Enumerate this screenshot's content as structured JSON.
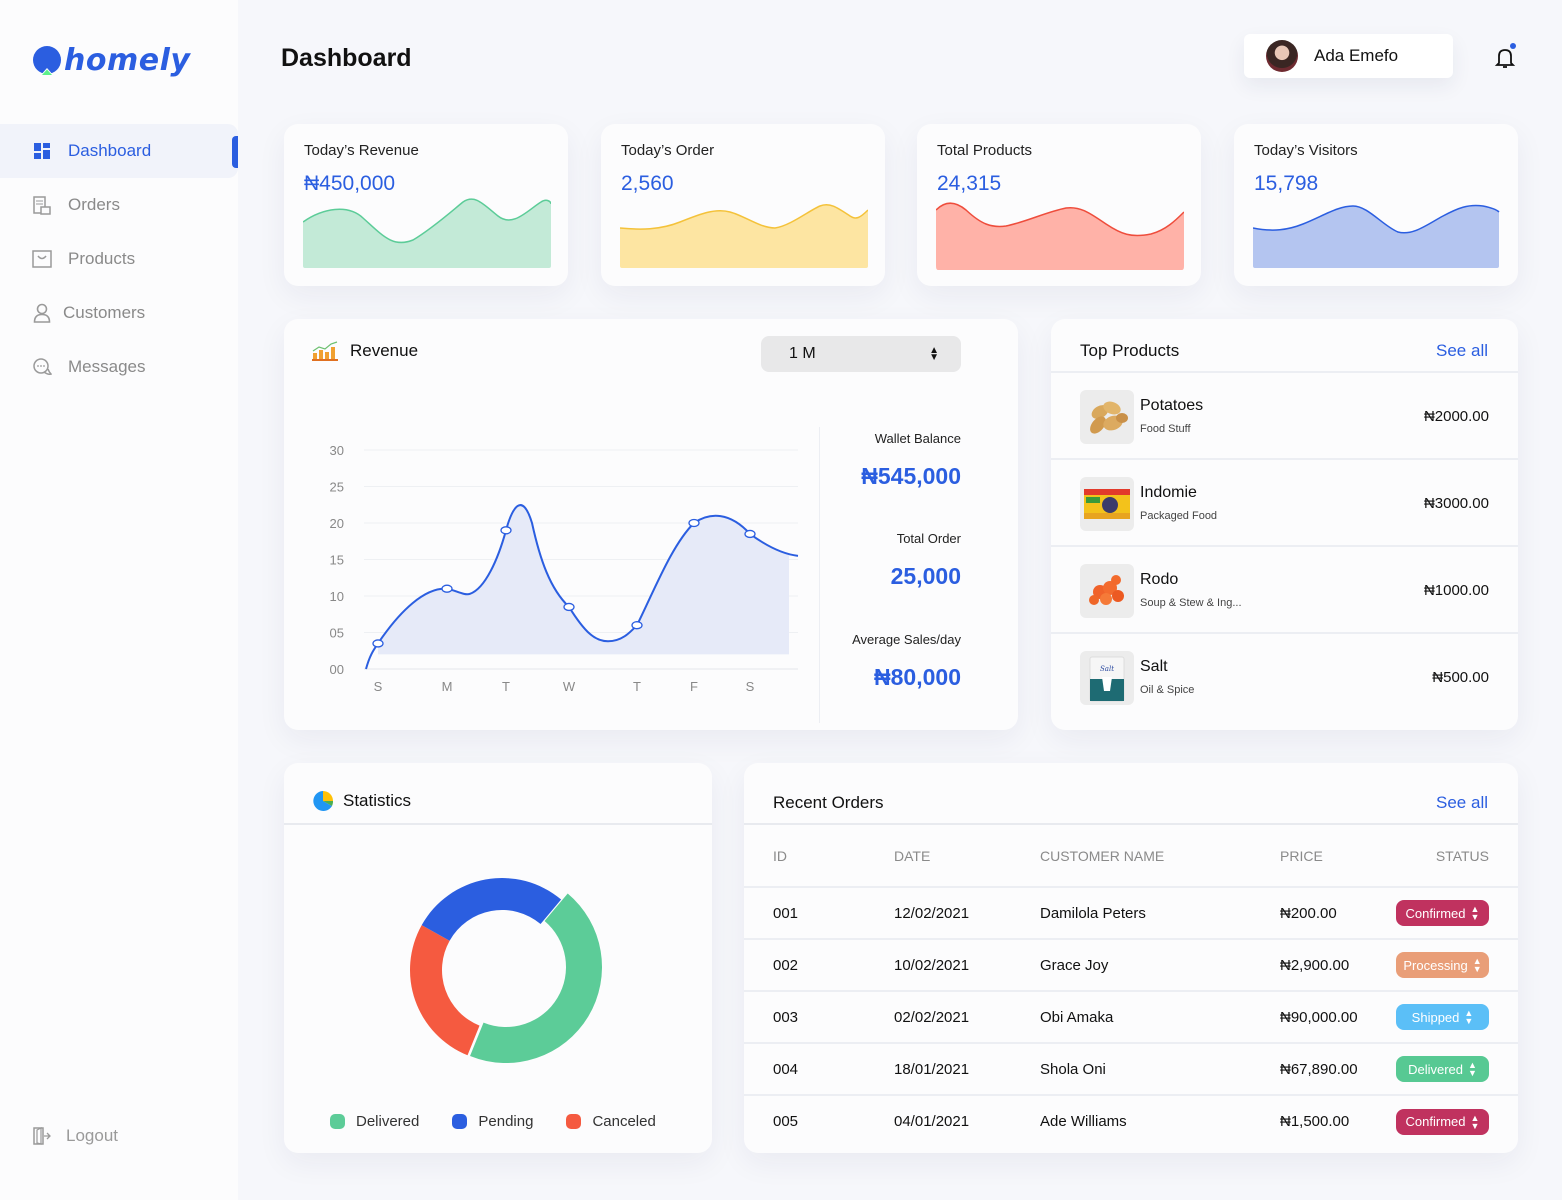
{
  "app": {
    "brand": "homely"
  },
  "sidebar": {
    "items": [
      {
        "label": "Dashboard",
        "icon": "grid-icon",
        "active": true
      },
      {
        "label": "Orders",
        "icon": "orders-icon",
        "active": false
      },
      {
        "label": "Products",
        "icon": "bag-icon",
        "active": false
      },
      {
        "label": "Customers",
        "icon": "user-icon",
        "active": false
      },
      {
        "label": "Messages",
        "icon": "chat-icon",
        "active": false
      }
    ],
    "logout_label": "Logout"
  },
  "header": {
    "title": "Dashboard",
    "user_name": "Ada Emefo",
    "has_notification": true
  },
  "stats": [
    {
      "label": "Today’s Revenue",
      "value": "₦450,000",
      "color": "#5ccc98",
      "fill": "#c3ead7"
    },
    {
      "label": "Today’s Order",
      "value": "2,560",
      "color": "#f4c23a",
      "fill": "#fde5a2"
    },
    {
      "label": "Total Products",
      "value": "24,315",
      "color": "#ee4d3c",
      "fill": "#ffb2a8"
    },
    {
      "label": "Today’s Visitors",
      "value": "15,798",
      "color": "#2b5ee0",
      "fill": "#b4c5f0"
    }
  ],
  "revenue": {
    "title": "Revenue",
    "period": "1 M",
    "metrics": [
      {
        "label": "Wallet Balance",
        "value": "₦545,000"
      },
      {
        "label": "Total Order",
        "value": "25,000"
      },
      {
        "label": "Average Sales/day",
        "value": "₦80,000"
      }
    ]
  },
  "chart_data": {
    "type": "area",
    "title": "Revenue",
    "categories": [
      "S",
      "M",
      "T",
      "W",
      "T",
      "F",
      "S"
    ],
    "y_ticks": [
      "00",
      "05",
      "10",
      "15",
      "20",
      "25",
      "30"
    ],
    "ylim": [
      0,
      30
    ],
    "series": [
      {
        "name": "Revenue",
        "values": [
          3.5,
          11,
          19,
          8.5,
          6,
          20,
          18.5
        ],
        "color": "#2b5ee0",
        "fill": "#e6eaf8"
      }
    ],
    "grid": true,
    "xlabel": "",
    "ylabel": ""
  },
  "top_products": {
    "title": "Top Products",
    "see_all": "See all",
    "items": [
      {
        "name": "Potatoes",
        "category": "Food Stuff",
        "price": "₦2000.00",
        "thumb": "potato"
      },
      {
        "name": "Indomie",
        "category": "Packaged Food",
        "price": "₦3000.00",
        "thumb": "noodles"
      },
      {
        "name": "Rodo",
        "category": "Soup & Stew & Ing...",
        "price": "₦1000.00",
        "thumb": "pepper"
      },
      {
        "name": "Salt",
        "category": "Oil & Spice",
        "price": "₦500.00",
        "thumb": "salt"
      }
    ]
  },
  "statistics": {
    "title": "Statistics",
    "segments": [
      {
        "name": "Delivered",
        "value": 45,
        "color": "#5ccc98"
      },
      {
        "name": "Pending",
        "value": 28,
        "color": "#2b5ee0"
      },
      {
        "name": "Canceled",
        "value": 27,
        "color": "#f55a40"
      }
    ]
  },
  "recent_orders": {
    "title": "Recent Orders",
    "see_all": "See all",
    "columns": [
      "ID",
      "DATE",
      "CUSTOMER NAME",
      "PRICE",
      "STATUS"
    ],
    "rows": [
      {
        "id": "001",
        "date": "12/02/2021",
        "customer": "Damilola Peters",
        "price": "₦200.00",
        "status": "Confirmed",
        "status_color": "#c0325f"
      },
      {
        "id": "002",
        "date": "10/02/2021",
        "customer": "Grace Joy",
        "price": "₦2,900.00",
        "status": "Processing",
        "status_color": "#e99e78"
      },
      {
        "id": "003",
        "date": "02/02/2021",
        "customer": "Obi Amaka",
        "price": "₦90,000.00",
        "status": "Shipped",
        "status_color": "#5bbff7"
      },
      {
        "id": "004",
        "date": "18/01/2021",
        "customer": "Shola Oni",
        "price": "₦67,890.00",
        "status": "Delivered",
        "status_color": "#57c993"
      },
      {
        "id": "005",
        "date": "04/01/2021",
        "customer": "Ade Williams",
        "price": "₦1,500.00",
        "status": "Confirmed",
        "status_color": "#c0325f"
      }
    ]
  }
}
